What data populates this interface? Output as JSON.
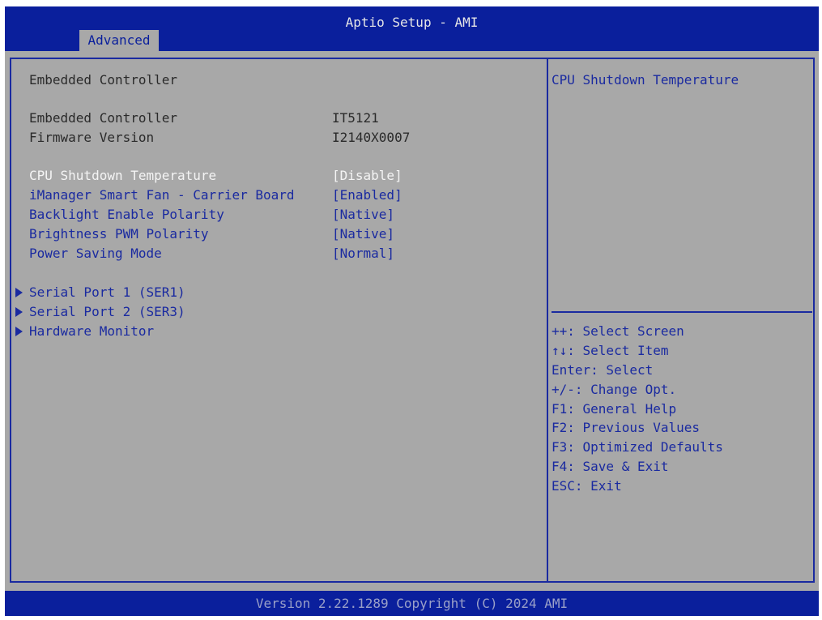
{
  "header": {
    "title": "Aptio Setup - AMI",
    "tab": "Advanced"
  },
  "main": {
    "section_title": "Embedded Controller",
    "info": [
      {
        "label": "Embedded Controller",
        "value": "IT5121"
      },
      {
        "label": "Firmware Version",
        "value": "I2140X0007"
      }
    ],
    "settings": [
      {
        "label": "CPU Shutdown Temperature",
        "value": "[Disable]",
        "selected": true
      },
      {
        "label": "iManager Smart Fan - Carrier Board",
        "value": "[Enabled]"
      },
      {
        "label": "Backlight Enable Polarity",
        "value": "[Native]"
      },
      {
        "label": "Brightness PWM Polarity",
        "value": "[Native]"
      },
      {
        "label": "Power Saving Mode",
        "value": "[Normal]"
      }
    ],
    "submenus": [
      {
        "label": "Serial Port 1 (SER1)"
      },
      {
        "label": "Serial Port 2 (SER3)"
      },
      {
        "label": "Hardware Monitor"
      }
    ]
  },
  "help": {
    "description": "CPU Shutdown Temperature",
    "keys": [
      "++: Select Screen",
      "↑↓: Select Item",
      "Enter: Select",
      "+/-: Change Opt.",
      "F1: General Help",
      "F2: Previous Values",
      "F3: Optimized Defaults",
      "F4: Save & Exit",
      "ESC: Exit"
    ]
  },
  "footer": {
    "version": "Version 2.22.1289 Copyright (C) 2024 AMI"
  },
  "colors": {
    "bar_blue": "#0a1f9c",
    "panel_gray": "#a8a8a8",
    "text_blue": "#1a2aa0",
    "highlight": "#f4f4f4"
  }
}
